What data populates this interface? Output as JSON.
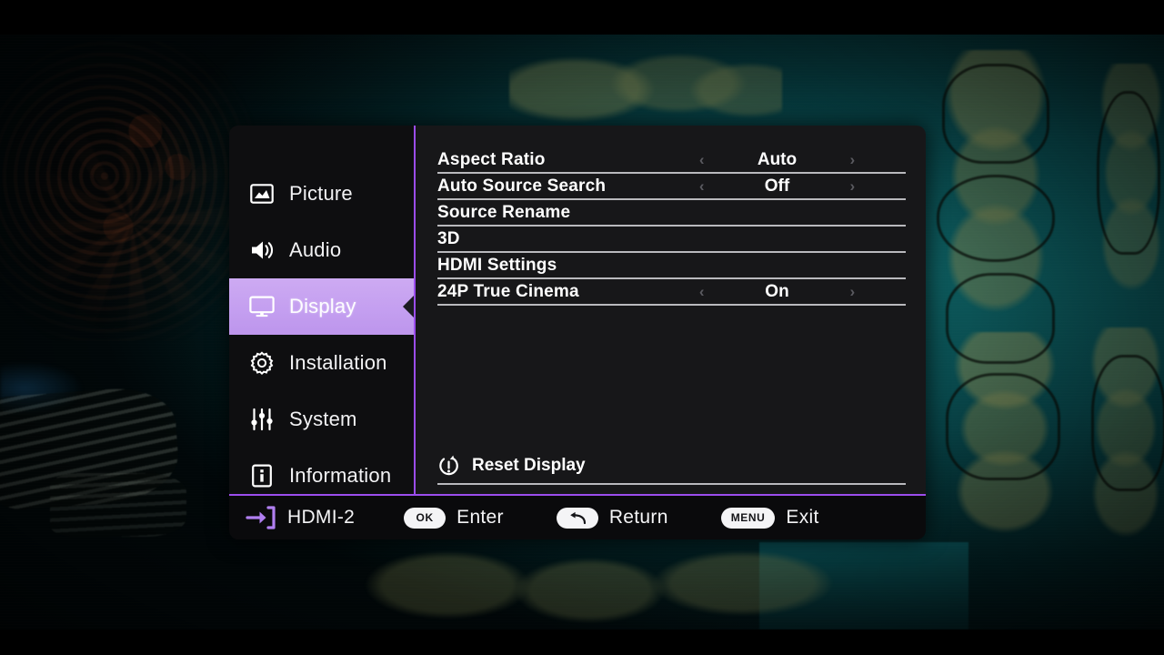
{
  "osd": {
    "sidebar": {
      "items": [
        {
          "label": "Picture",
          "icon": "picture-icon",
          "active": false
        },
        {
          "label": "Audio",
          "icon": "speaker-icon",
          "active": false
        },
        {
          "label": "Display",
          "icon": "monitor-icon",
          "active": true
        },
        {
          "label": "Installation",
          "icon": "gear-icon",
          "active": false
        },
        {
          "label": "System",
          "icon": "sliders-icon",
          "active": false
        },
        {
          "label": "Information",
          "icon": "info-box-icon",
          "active": false
        }
      ],
      "highlight_color": "#c49ff0",
      "accent_color": "#9b4ded"
    },
    "settings": {
      "rows": [
        {
          "label": "Aspect Ratio",
          "value": "Auto",
          "has_arrows": true
        },
        {
          "label": "Auto Source Search",
          "value": "Off",
          "has_arrows": true
        },
        {
          "label": "Source Rename",
          "value": "",
          "has_arrows": false
        },
        {
          "label": "3D",
          "value": "",
          "has_arrows": false
        },
        {
          "label": "HDMI Settings",
          "value": "",
          "has_arrows": false
        },
        {
          "label": "24P True Cinema",
          "value": "On",
          "has_arrows": true
        }
      ],
      "left_arrow": "‹",
      "right_arrow": "›",
      "reset": {
        "label": "Reset Display",
        "icon": "reset-power-icon"
      }
    },
    "footer": {
      "source": {
        "icon": "input-arrow-icon",
        "label": "HDMI-2"
      },
      "hints": [
        {
          "key": "OK",
          "key_type": "text",
          "label": "Enter"
        },
        {
          "key": "",
          "key_type": "return-arrow-icon",
          "label": "Return"
        },
        {
          "key": "MENU",
          "key_type": "text",
          "label": "Exit"
        }
      ]
    }
  }
}
